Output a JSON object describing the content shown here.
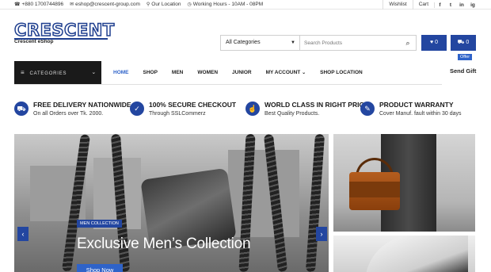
{
  "topbar": {
    "phone": "+880 1700744896",
    "email": "eshop@crescent-group.com",
    "location": "Our Location",
    "hours": "Working Hours - 10AM - 08PM",
    "wishlist": "Wishlist",
    "cart": "Cart",
    "social": [
      "f",
      "t",
      "in",
      "ig"
    ]
  },
  "logo": {
    "name": "CRESCENT",
    "sub": "Crescent eShop"
  },
  "search": {
    "category": "All Categories",
    "placeholder": "Search Products"
  },
  "header_buttons": {
    "wishlist_count": "0",
    "cart_count": "0"
  },
  "nav": {
    "categories_label": "CATEGORIES",
    "items": [
      "HOME",
      "SHOP",
      "MEN",
      "WOMEN",
      "JUNIOR",
      "MY ACCOUNT",
      "SHOP LOCATION"
    ],
    "offer_badge": "Offer",
    "send_gift": "Send Gift"
  },
  "features": [
    {
      "title": "FREE DELIVERY NATIONWIDE",
      "sub": "On all Orders over Tk. 2000.",
      "icon": "truck-icon"
    },
    {
      "title": "100% SECURE CHECKOUT",
      "sub": "Through SSLCommerz",
      "icon": "shield-check-icon"
    },
    {
      "title": "WORLD CLASS IN RIGHT PRICE",
      "sub": "Best Quality Products.",
      "icon": "thumbs-up-icon"
    },
    {
      "title": "PRODUCT WARRANTY",
      "sub": "Cover Manuf. fault within 30 days",
      "icon": "wrench-icon"
    }
  ],
  "hero": {
    "tag": "MEN COLLECTION",
    "title": "Exclusive Men’s Collection",
    "button": "Shop Now"
  },
  "colors": {
    "brand": "#2346a0",
    "accent": "#2f63c9",
    "category_bar": "#1a1a1a"
  }
}
